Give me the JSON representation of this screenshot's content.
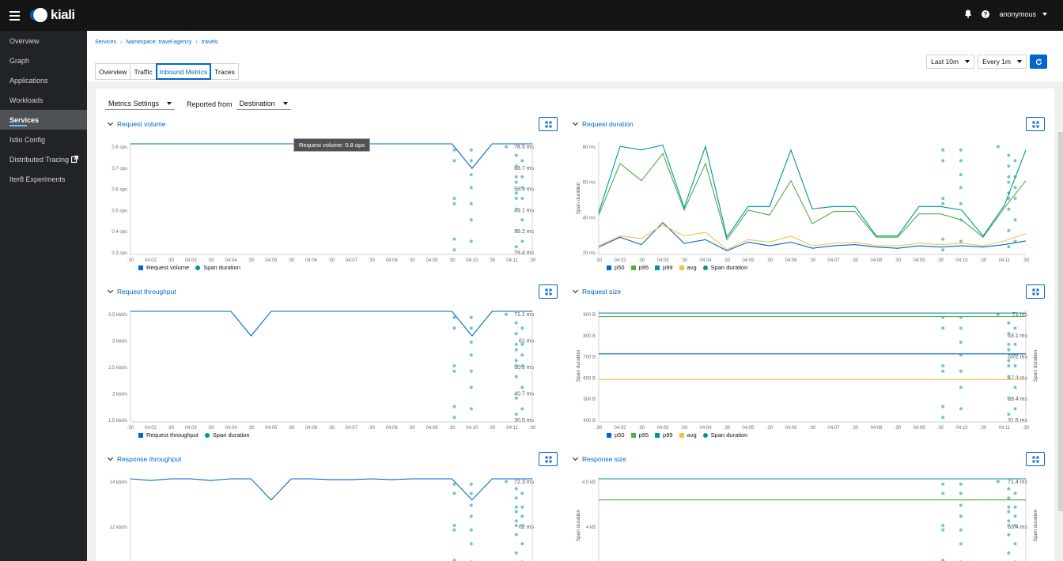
{
  "header": {
    "logo_text": "kiali",
    "user": "anonymous"
  },
  "icons": {
    "hamburger": "hamburger-icon",
    "bell": "bell-icon",
    "help": "help-icon",
    "external": "external-link-icon",
    "refresh": "refresh-icon",
    "expand": "expand-icon"
  },
  "sidebar": {
    "items": [
      {
        "label": "Overview"
      },
      {
        "label": "Graph"
      },
      {
        "label": "Applications"
      },
      {
        "label": "Workloads"
      },
      {
        "label": "Services"
      },
      {
        "label": "Istio Config"
      },
      {
        "label": "Distributed Tracing"
      },
      {
        "label": "Iter8 Experiments"
      }
    ],
    "active": "Services"
  },
  "breadcrumb": [
    "Services",
    "Namespace: travel-agency",
    "travels"
  ],
  "tabs": [
    "Overview",
    "Traffic",
    "Inbound Metrics",
    "Traces"
  ],
  "active_tab": "Inbound Metrics",
  "toolbar": {
    "duration": "Last 10m",
    "refresh_interval": "Every 1m"
  },
  "metric_controls": {
    "settings_label": "Metrics Settings",
    "reported_from_label": "Reported from",
    "reported_from_value": "Destination"
  },
  "colors": {
    "blue": "#06c",
    "green": "#4cb140",
    "teal": "#009596",
    "orange": "#f4c145",
    "scatter": "#73c5c5"
  },
  "chart_data": [
    {
      "type": "line",
      "title": "Request volume",
      "x_ticks": [
        ":30",
        "04:02",
        ":30",
        "04:03",
        ":30",
        "04:04",
        ":30",
        "04:05",
        ":30",
        "04:06",
        ":30",
        "04:07",
        ":30",
        "04:08",
        ":30",
        "04:09",
        ":30",
        "04:10",
        ":30",
        "04:11",
        ":30"
      ],
      "y_ticks": [
        "0.8 ops",
        "0.7 ops",
        "0.6 ops",
        "0.5 ops",
        "0.4 ops",
        "0.3 ops"
      ],
      "y_ticks_right": [
        "78.5 ms",
        "68.7 ms",
        "58.9 ms",
        "49.1 ms",
        "39.2 ms",
        "29.4 ms"
      ],
      "series": [
        {
          "name": "Request volume",
          "values": [
            0.8,
            0.8,
            0.8,
            0.8,
            0.8,
            0.8,
            0.8,
            0.8,
            0.8,
            0.8,
            0.8,
            0.8,
            0.8,
            0.8,
            0.8,
            0.8,
            0.8,
            0.73,
            0.8,
            0.8,
            0.8
          ]
        },
        {
          "name": "Span duration",
          "kind": "scatter"
        }
      ],
      "tooltip": "Request volume: 0.8 ops",
      "legend": [
        "Request volume",
        "Span duration"
      ]
    },
    {
      "type": "line",
      "title": "Request duration",
      "ylabel": "Span duration",
      "x_ticks": [
        ":30",
        "04:02",
        ":30",
        "04:03",
        ":30",
        "04:04",
        ":30",
        "04:05",
        ":30",
        "04:06",
        ":30",
        "04:07",
        ":30",
        "04:08",
        ":30",
        "04:09",
        ":30",
        "04:10",
        ":30",
        "04:11",
        ":30"
      ],
      "y_ticks": [
        "80 ms",
        "60 ms",
        "40 ms",
        "20 ms"
      ],
      "ylim": [
        10,
        100
      ],
      "series": [
        {
          "name": "p50",
          "values": [
            16,
            24,
            18,
            36,
            19,
            22,
            13,
            20,
            17,
            20,
            15,
            17,
            18,
            16,
            15,
            17,
            16,
            17,
            16,
            18,
            21
          ]
        },
        {
          "name": "p95",
          "values": [
            42,
            84,
            70,
            92,
            46,
            84,
            22,
            46,
            42,
            70,
            35,
            45,
            45,
            24,
            24,
            43,
            43,
            38,
            24,
            48,
            70
          ]
        },
        {
          "name": "p99",
          "values": [
            44,
            98,
            95,
            99,
            48,
            98,
            24,
            49,
            49,
            95,
            47,
            49,
            49,
            25,
            25,
            49,
            49,
            46,
            25,
            50,
            95
          ]
        },
        {
          "name": "avg",
          "values": [
            17,
            25,
            23,
            34,
            25,
            28,
            14,
            22,
            20,
            25,
            17,
            19,
            20,
            17,
            17,
            19,
            18,
            19,
            17,
            21,
            27
          ]
        },
        {
          "name": "Span duration",
          "kind": "scatter"
        }
      ],
      "legend": [
        "p50",
        "p95",
        "p99",
        "avg",
        "Span duration"
      ]
    },
    {
      "type": "line",
      "title": "Request throughput",
      "x_ticks": [
        ":30",
        "04:02",
        ":30",
        "04:03",
        ":30",
        "04:04",
        ":30",
        "04:05",
        ":30",
        "04:06",
        ":30",
        "04:07",
        ":30",
        "04:08",
        ":30",
        "04:09",
        ":30",
        "04:10",
        ":30",
        "04:11",
        ":30"
      ],
      "y_ticks": [
        "3.5 kbit/s",
        "3 kbit/s",
        "2.5 kbit/s",
        "2 kbit/s",
        "1.5 kbit/s"
      ],
      "y_ticks_right": [
        "71.1 ms",
        "61 ms",
        "50.8 ms",
        "40.7 ms",
        "30.5 ms"
      ],
      "series": [
        {
          "name": "Request throughput",
          "values": [
            3.9,
            3.9,
            3.9,
            3.9,
            3.9,
            3.9,
            3.2,
            3.9,
            3.9,
            3.9,
            3.9,
            3.9,
            3.9,
            3.9,
            3.9,
            3.9,
            3.9,
            3.2,
            3.9,
            3.9,
            3.9
          ]
        },
        {
          "name": "Span duration",
          "kind": "scatter"
        }
      ],
      "legend": [
        "Request throughput",
        "Span duration"
      ]
    },
    {
      "type": "line",
      "title": "Request size",
      "ylabel": "Span duration",
      "x_ticks": [
        ":30",
        "04:02",
        ":30",
        "04:03",
        ":30",
        "04:04",
        ":30",
        "04:05",
        ":30",
        "04:06",
        ":30",
        "04:07",
        ":30",
        "04:08",
        ":30",
        "04:09",
        ":30",
        "04:10",
        ":30",
        "04:11",
        ":30"
      ],
      "y_ticks": [
        "900 B",
        "800 B",
        "700 B",
        "600 B",
        "500 B",
        "400 B"
      ],
      "y_ticks_right": [
        "71 ms",
        "63.1 ms",
        "55.2 ms",
        "47.3 ms",
        "39.4 ms",
        "31.6 ms"
      ],
      "ylim": [
        350,
        1000
      ],
      "series": [
        {
          "name": "p50",
          "values": [
            750,
            750,
            750,
            750,
            750,
            750,
            750,
            750,
            750,
            750,
            750,
            750,
            750,
            750,
            750,
            750,
            750,
            750,
            750,
            750,
            750
          ]
        },
        {
          "name": "p95",
          "values": [
            970,
            970,
            970,
            970,
            970,
            970,
            970,
            970,
            970,
            970,
            970,
            970,
            970,
            970,
            970,
            970,
            970,
            970,
            970,
            970,
            970
          ]
        },
        {
          "name": "p99",
          "values": [
            990,
            990,
            990,
            990,
            990,
            990,
            990,
            990,
            990,
            990,
            990,
            990,
            990,
            990,
            990,
            990,
            990,
            990,
            990,
            990,
            990
          ]
        },
        {
          "name": "avg",
          "values": [
            600,
            600,
            600,
            600,
            600,
            600,
            600,
            600,
            600,
            600,
            600,
            600,
            600,
            600,
            600,
            600,
            600,
            600,
            600,
            600,
            600
          ]
        },
        {
          "name": "Span duration",
          "kind": "scatter"
        }
      ],
      "legend": [
        "p50",
        "p95",
        "p99",
        "avg",
        "Span duration"
      ]
    },
    {
      "type": "line",
      "title": "Response throughput",
      "y_ticks": [
        "14 kbit/s",
        "12 kbit/s",
        "10 kbit/s"
      ],
      "y_ticks_right": [
        "72.3 ms",
        "62 ms",
        "51.6 ms"
      ],
      "series": [
        {
          "name": "Response throughput",
          "values": [
            15,
            14.8,
            15,
            15,
            14.8,
            15,
            15,
            12.5,
            15,
            15,
            14.9,
            14.9,
            15,
            14.9,
            15,
            15,
            15,
            12.5,
            15,
            15,
            15
          ]
        },
        {
          "name": "Span duration",
          "kind": "scatter"
        }
      ]
    },
    {
      "type": "line",
      "title": "Response size",
      "ylabel": "Span duration",
      "y_ticks": [
        "4.5 kB",
        "4 kB",
        "3.5 kB"
      ],
      "y_ticks_right": [
        "71.4 ms",
        "63.4 ms",
        "55.5 ms"
      ],
      "series": [
        {
          "name": "p95",
          "values": [
            4.9,
            4.9,
            4.9,
            4.9,
            4.9,
            4.9,
            4.9,
            4.9,
            4.9,
            4.9,
            4.9,
            4.9,
            4.9,
            4.9,
            4.9,
            4.9,
            4.9,
            4.9,
            4.9,
            4.9,
            4.9
          ]
        },
        {
          "name": "p99",
          "values": [
            5.1,
            5.1,
            5.1,
            5.1,
            5.1,
            5.1,
            5.1,
            5.1,
            5.1,
            5.1,
            5.1,
            5.1,
            5.1,
            5.1,
            5.1,
            5.1,
            5.1,
            5.1,
            5.1,
            5.1,
            5.1
          ]
        },
        {
          "name": "Span duration",
          "kind": "scatter"
        }
      ]
    }
  ]
}
